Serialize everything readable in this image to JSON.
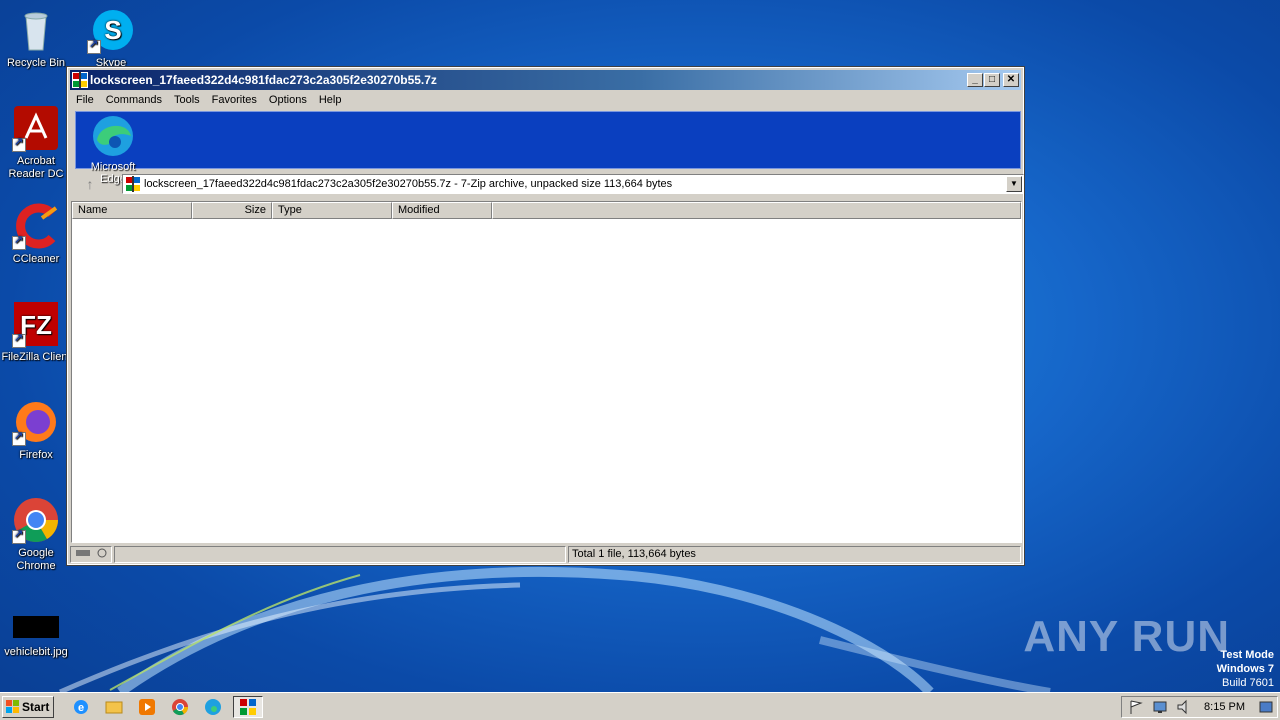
{
  "desktop": {
    "icons": [
      {
        "label": "Recycle Bin",
        "icon": "recycle-bin-icon"
      },
      {
        "label": "Skype",
        "icon": "skype-icon"
      },
      {
        "label": "Acrobat Reader DC",
        "icon": "acrobat-icon"
      },
      {
        "label": "CCleaner",
        "icon": "ccleaner-icon"
      },
      {
        "label": "FileZilla Client",
        "icon": "filezilla-icon"
      },
      {
        "label": "Firefox",
        "icon": "firefox-icon"
      },
      {
        "label": "Google Chrome",
        "icon": "chrome-icon"
      },
      {
        "label": "vehiclebit.jpg",
        "icon": "image-file-icon"
      },
      {
        "label": "Microsoft Edge",
        "icon": "edge-icon"
      }
    ]
  },
  "window": {
    "title": "lockscreen_17faeed322d4c981fdac273c2a305f2e30270b55.7z",
    "menu": [
      "File",
      "Commands",
      "Tools",
      "Favorites",
      "Options",
      "Help"
    ],
    "address": "lockscreen_17faeed322d4c981fdac273c2a305f2e30270b55.7z - 7-Zip archive, unpacked size 113,664 bytes",
    "columns": [
      "Name",
      "Size",
      "Type",
      "Modified"
    ],
    "status_total": "Total 1 file, 113,664 bytes"
  },
  "watermark": {
    "text": "ANY RUN"
  },
  "testmode": {
    "line1": "Test Mode",
    "line2": "Windows 7",
    "line3": "Build 7601"
  },
  "taskbar": {
    "start_label": "Start",
    "clock": "8:15 PM"
  },
  "colors": {
    "desktop_bg": "#1666c9",
    "titlebar": "#0a246a",
    "toolband": "#0a3fbf"
  }
}
